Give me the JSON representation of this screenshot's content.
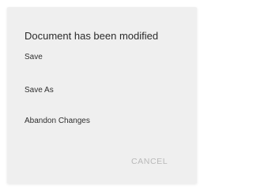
{
  "dialog": {
    "title": "Document has been modified",
    "options": [
      {
        "label": "Save"
      },
      {
        "label": "Save As"
      },
      {
        "label": "Abandon Changes"
      }
    ],
    "cancel_label": "CANCEL"
  }
}
